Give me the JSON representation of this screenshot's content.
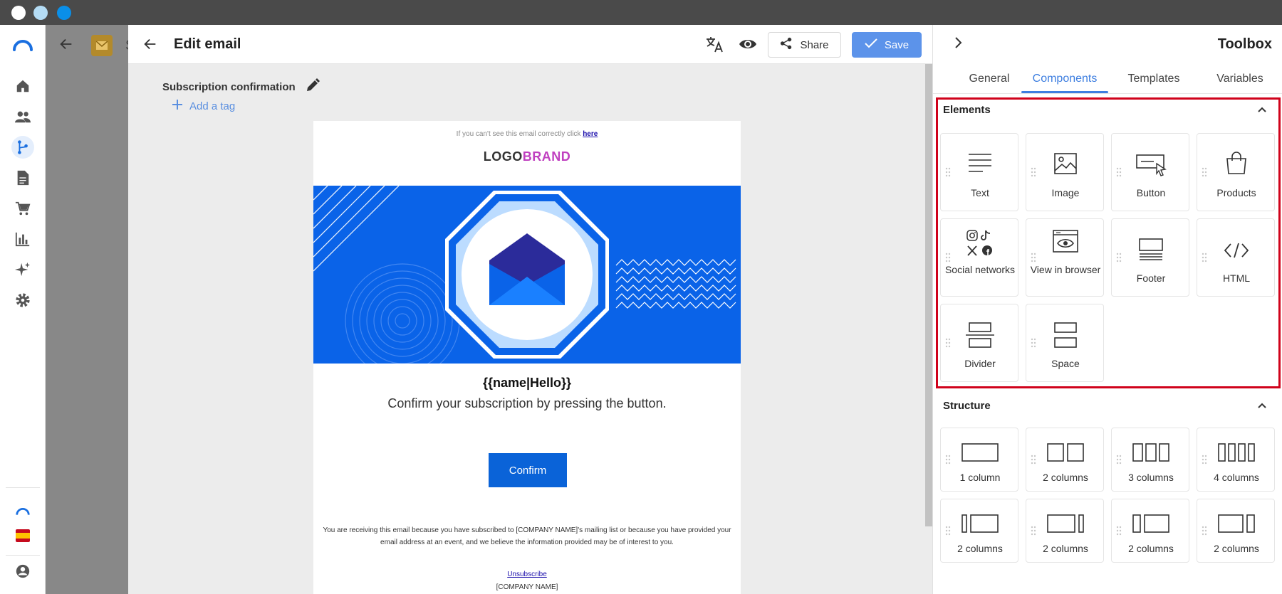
{
  "window_controls": {
    "colors": [
      "#ffffff",
      "#b4dcf5",
      "#0a8fe8"
    ]
  },
  "nav": {
    "items": [
      "home-icon",
      "people-icon",
      "flow-icon",
      "document-icon",
      "cart-icon",
      "chart-icon",
      "sparkle-icon",
      "gear-icon"
    ],
    "active": "flow-icon",
    "accent": "#1a6fe0"
  },
  "background_app": {
    "title_initial": "S"
  },
  "editor": {
    "title": "Edit email",
    "share_label": "Share",
    "save_label": "Save",
    "subject": "Subscription confirmation",
    "add_tag_label": "Add a tag"
  },
  "email": {
    "preheader_text": "If you can't see this email correctly click",
    "preheader_link": "here",
    "logo_part1": "LOGO",
    "logo_part2": "BRAND",
    "greeting": "{{name|Hello}}",
    "message": "Confirm your subscription by pressing the button.",
    "button_label": "Confirm",
    "disclaimer": "You are receiving this email because you have subscribed to [COMPANY NAME]'s mailing list or because you have provided your email address at an event, and we believe the information provided may be of interest to you.",
    "unsubscribe": "Unsubscribe",
    "company": "[COMPANY NAME]",
    "hero_color": "#0a63e8"
  },
  "toolbox": {
    "title": "Toolbox",
    "tabs": [
      "General",
      "Components",
      "Templates",
      "Variables"
    ],
    "active_tab": "Components",
    "elements_title": "Elements",
    "elements": [
      "Text",
      "Image",
      "Button",
      "Products",
      "Social networks",
      "View in browser",
      "Footer",
      "HTML",
      "Divider",
      "Space"
    ],
    "structure_title": "Structure",
    "structure": [
      "1 column",
      "2 columns",
      "3 columns",
      "4 columns",
      "2 columns",
      "2 columns",
      "2 columns",
      "2 columns"
    ],
    "highlight_color": "#d0021b"
  }
}
